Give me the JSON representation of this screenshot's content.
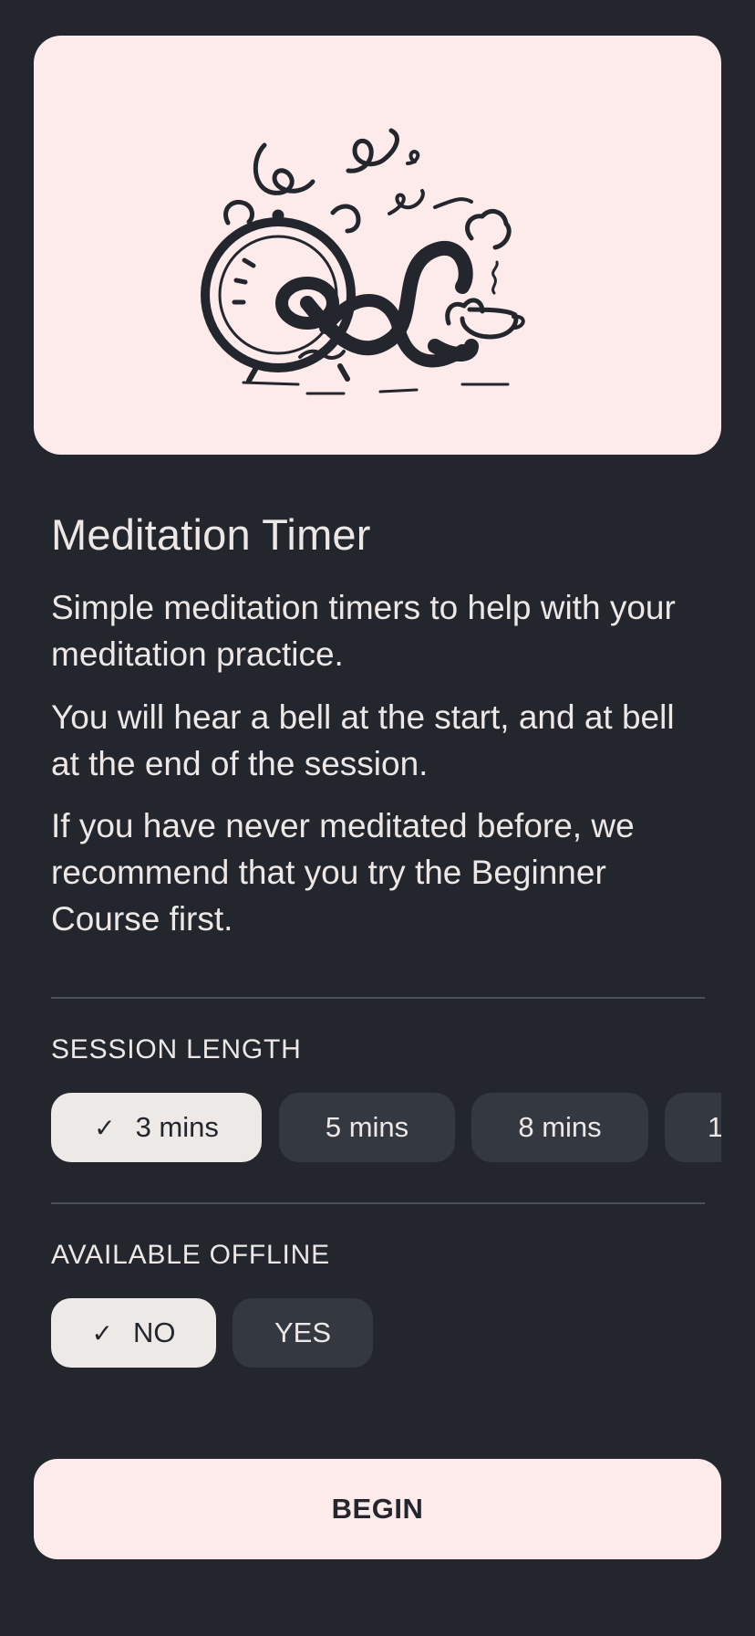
{
  "hero": {
    "illustration": "alarm-clock-meditation-illustration"
  },
  "title": "Meditation Timer",
  "paragraphs": [
    "Simple meditation timers to help with your meditation practice.",
    "You will hear a bell at the start, and at bell at the end of the session.",
    "If you have never meditated before, we recommend that you try the Beginner Course first."
  ],
  "session_length": {
    "label": "SESSION LENGTH",
    "options": [
      "3 mins",
      "5 mins",
      "8 mins",
      "1"
    ],
    "selected": "3 mins",
    "check_icon": "✓"
  },
  "available_offline": {
    "label": "AVAILABLE OFFLINE",
    "options": [
      "NO",
      "YES"
    ],
    "selected": "NO",
    "check_icon": "✓"
  },
  "begin_label": "BEGIN",
  "colors": {
    "background": "#23272d",
    "card": "#fdeaea",
    "chip": "#343941",
    "chip_selected": "#ece9e6",
    "text": "#ede8e6"
  }
}
